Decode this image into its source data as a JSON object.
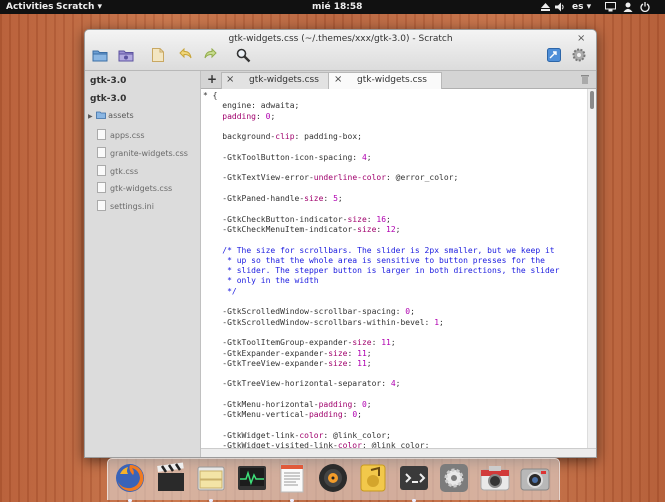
{
  "panel": {
    "activities": "Activities",
    "app_menu": "Scratch",
    "clock": "mié 18:58",
    "language": "es"
  },
  "window": {
    "title": "gtk-widgets.css (~/.themes/xxx/gtk-3.0) - Scratch",
    "close": "×"
  },
  "toolbar": {
    "icons": [
      "folder-open-icon",
      "folder-templates-icon",
      "save-icon",
      "undo-icon",
      "redo-icon",
      "search-icon",
      "share-icon",
      "settings-icon"
    ]
  },
  "sidebar": {
    "roots": [
      "gtk-3.0",
      "gtk-3.0"
    ],
    "folder": "assets",
    "files": [
      "apps.css",
      "granite-widgets.css",
      "gtk.css",
      "gtk-widgets.css",
      "settings.ini"
    ]
  },
  "tabs": {
    "new_tab": "+",
    "items": [
      {
        "label": "gtk-widgets.css",
        "close": "×",
        "active": false
      },
      {
        "label": "gtk-widgets.css",
        "close": "×",
        "active": true
      }
    ],
    "trash": "🗑"
  },
  "editor": {
    "lines": [
      {
        "parts": [
          {
            "t": "* {"
          }
        ]
      },
      {
        "parts": [
          {
            "t": "    engine: adwaita;"
          }
        ]
      },
      {
        "parts": [
          {
            "t": "    padding",
            "c": "kw"
          },
          {
            "t": ": "
          },
          {
            "t": "0",
            "c": "num"
          },
          {
            "t": ";"
          }
        ]
      },
      {
        "parts": [
          {
            "t": ""
          }
        ]
      },
      {
        "parts": [
          {
            "t": "    background-"
          },
          {
            "t": "clip",
            "c": "kw"
          },
          {
            "t": ": padding-box;"
          }
        ]
      },
      {
        "parts": [
          {
            "t": ""
          }
        ]
      },
      {
        "parts": [
          {
            "t": "    -GtkToolButton-icon-spacing: "
          },
          {
            "t": "4",
            "c": "num"
          },
          {
            "t": ";"
          }
        ]
      },
      {
        "parts": [
          {
            "t": ""
          }
        ]
      },
      {
        "parts": [
          {
            "t": "    -GtkTextView-error-"
          },
          {
            "t": "underline-color",
            "c": "kw"
          },
          {
            "t": ": @error_color;"
          }
        ]
      },
      {
        "parts": [
          {
            "t": ""
          }
        ]
      },
      {
        "parts": [
          {
            "t": "    -GtkPaned-handle-"
          },
          {
            "t": "size",
            "c": "kw"
          },
          {
            "t": ": "
          },
          {
            "t": "5",
            "c": "num"
          },
          {
            "t": ";"
          }
        ]
      },
      {
        "parts": [
          {
            "t": ""
          }
        ]
      },
      {
        "parts": [
          {
            "t": "    -GtkCheckButton-indicator-"
          },
          {
            "t": "size",
            "c": "kw"
          },
          {
            "t": ": "
          },
          {
            "t": "16",
            "c": "num"
          },
          {
            "t": ";"
          }
        ]
      },
      {
        "parts": [
          {
            "t": "    -GtkCheckMenuItem-indicator-"
          },
          {
            "t": "size",
            "c": "kw"
          },
          {
            "t": ": "
          },
          {
            "t": "12",
            "c": "num"
          },
          {
            "t": ";"
          }
        ]
      },
      {
        "parts": [
          {
            "t": ""
          }
        ]
      },
      {
        "parts": [
          {
            "t": "    /* The size for scrollbars. The slider is 2px smaller, but we keep it",
            "c": "cm"
          }
        ]
      },
      {
        "parts": [
          {
            "t": "     * up so that the whole area is sensitive to button presses for the",
            "c": "cm"
          }
        ]
      },
      {
        "parts": [
          {
            "t": "     * slider. The stepper button is larger in both directions, the slider",
            "c": "cm"
          }
        ]
      },
      {
        "parts": [
          {
            "t": "     * only in the width",
            "c": "cm"
          }
        ]
      },
      {
        "parts": [
          {
            "t": "     */",
            "c": "cm"
          }
        ]
      },
      {
        "parts": [
          {
            "t": ""
          }
        ]
      },
      {
        "parts": [
          {
            "t": "    -GtkScrolledWindow-scrollbar-spacing: "
          },
          {
            "t": "0",
            "c": "num"
          },
          {
            "t": ";"
          }
        ]
      },
      {
        "parts": [
          {
            "t": "    -GtkScrolledWindow-scrollbars-within-bevel: "
          },
          {
            "t": "1",
            "c": "num"
          },
          {
            "t": ";"
          }
        ]
      },
      {
        "parts": [
          {
            "t": ""
          }
        ]
      },
      {
        "parts": [
          {
            "t": "    -GtkToolItemGroup-expander-"
          },
          {
            "t": "size",
            "c": "kw"
          },
          {
            "t": ": "
          },
          {
            "t": "11",
            "c": "num"
          },
          {
            "t": ";"
          }
        ]
      },
      {
        "parts": [
          {
            "t": "    -GtkExpander-expander-"
          },
          {
            "t": "size",
            "c": "kw"
          },
          {
            "t": ": "
          },
          {
            "t": "11",
            "c": "num"
          },
          {
            "t": ";"
          }
        ]
      },
      {
        "parts": [
          {
            "t": "    -GtkTreeView-expander-"
          },
          {
            "t": "size",
            "c": "kw"
          },
          {
            "t": ": "
          },
          {
            "t": "11",
            "c": "num"
          },
          {
            "t": ";"
          }
        ]
      },
      {
        "parts": [
          {
            "t": ""
          }
        ]
      },
      {
        "parts": [
          {
            "t": "    -GtkTreeView-horizontal-separator: "
          },
          {
            "t": "4",
            "c": "num"
          },
          {
            "t": ";"
          }
        ]
      },
      {
        "parts": [
          {
            "t": ""
          }
        ]
      },
      {
        "parts": [
          {
            "t": "    -GtkMenu-horizontal-"
          },
          {
            "t": "padding",
            "c": "kw"
          },
          {
            "t": ": "
          },
          {
            "t": "0",
            "c": "num"
          },
          {
            "t": ";"
          }
        ]
      },
      {
        "parts": [
          {
            "t": "    -GtkMenu-vertical-"
          },
          {
            "t": "padding",
            "c": "kw"
          },
          {
            "t": ": "
          },
          {
            "t": "0",
            "c": "num"
          },
          {
            "t": ";"
          }
        ]
      },
      {
        "parts": [
          {
            "t": ""
          }
        ]
      },
      {
        "parts": [
          {
            "t": "    -GtkWidget-link-"
          },
          {
            "t": "color",
            "c": "kw"
          },
          {
            "t": ": @link_color;"
          }
        ]
      },
      {
        "parts": [
          {
            "t": "    -GtkWidget-visited-link-"
          },
          {
            "t": "color",
            "c": "kw"
          },
          {
            "t": ": @link_color;"
          }
        ]
      }
    ]
  },
  "dock": {
    "apps": [
      {
        "name": "firefox-icon",
        "running": true
      },
      {
        "name": "video-clapper-icon",
        "running": false
      },
      {
        "name": "file-manager-icon",
        "running": true
      },
      {
        "name": "system-monitor-icon",
        "running": false
      },
      {
        "name": "text-editor-icon",
        "running": true
      },
      {
        "name": "music-player-icon",
        "running": false
      },
      {
        "name": "audio-player-icon",
        "running": false
      },
      {
        "name": "terminal-icon",
        "running": true
      },
      {
        "name": "system-settings-icon",
        "running": false
      },
      {
        "name": "photo-camera-icon",
        "running": false
      },
      {
        "name": "webcam-icon",
        "running": false
      }
    ]
  },
  "colors": {
    "keyword": "#a0006c",
    "number": "#b000b0",
    "comment": "#2020e0",
    "panel": "#111111"
  }
}
